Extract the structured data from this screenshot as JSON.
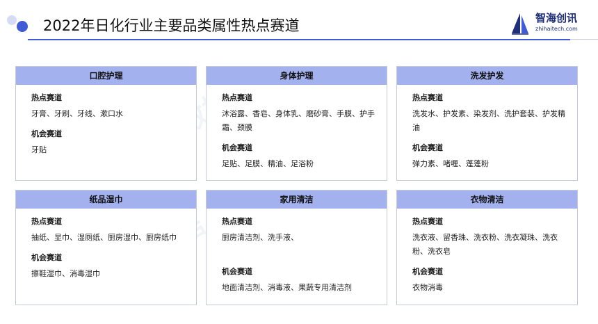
{
  "header": {
    "title": "2022年日化行业主要品类属性热点赛道",
    "brand_name": "智海创讯",
    "brand_url": "zhihaitech.com"
  },
  "watermark": "观向数据",
  "colors": {
    "accent": "#3f5bd6",
    "card_header": "#a3b1ef",
    "brand": "#1f2f7a"
  },
  "cards": [
    {
      "title": "口腔护理",
      "hot_label": "热点赛道",
      "hot_items": "牙膏、牙刷、牙线、漱口水",
      "opp_label": "机会赛道",
      "opp_items": "牙贴"
    },
    {
      "title": "身体护理",
      "hot_label": "热点赛道",
      "hot_items": "沐浴露、香皂、身体乳、磨砂膏、手膜、护手霜、颈膜",
      "opp_label": "机会赛道",
      "opp_items": "足贴、足膜、精油、足浴粉"
    },
    {
      "title": "洗发护发",
      "hot_label": "热点赛道",
      "hot_items": "洗发水、护发素、染发剂、洗护套装、护发精油",
      "opp_label": "机会赛道",
      "opp_items": "弹力素、啫喱、蓬蓬粉"
    },
    {
      "title": "纸品湿巾",
      "hot_label": "热点赛道",
      "hot_items": "抽纸、显巾、湿厕纸、厨房湿巾、厨房纸巾",
      "opp_label": "机会赛道",
      "opp_items": "擦鞋湿巾、消毒湿巾"
    },
    {
      "title": "家用清洁",
      "hot_label": "热点赛道",
      "hot_items": "厨房清洁剂、洗手液、",
      "opp_label": "机会赛道",
      "opp_items": "地面清洁剂、消毒液、果蔬专用清洁剂"
    },
    {
      "title": "衣物清洁",
      "hot_label": "热点赛道",
      "hot_items": "洗衣液、留香珠、洗衣粉、洗衣凝珠、洗衣粉、洗衣皂",
      "opp_label": "机会赛道",
      "opp_items": "衣物消毒"
    }
  ]
}
